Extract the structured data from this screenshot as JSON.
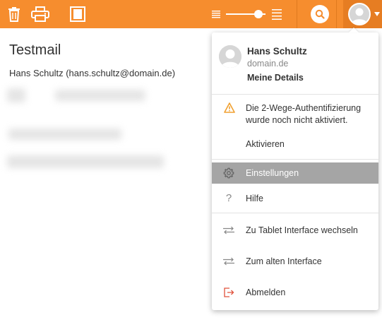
{
  "toolbar": {
    "icons": {
      "delete": "trash-icon",
      "print": "printer-icon",
      "view": "reading-pane-icon",
      "zoom_out": "text-size-small-icon",
      "zoom_in": "text-size-large-icon",
      "search": "search-icon",
      "account": "avatar-icon",
      "account_menu": "caret-down-icon"
    },
    "zoom_level": 0.82
  },
  "mail": {
    "subject": "Testmail",
    "from": "Hans Schultz (hans.schultz@domain.de)"
  },
  "account_menu": {
    "name": "Hans Schultz",
    "domain": "domain.de",
    "details_link": "Meine Details",
    "warning": {
      "icon": "warning-triangle-icon",
      "text": "Die 2-Wege-Authentifizierung wurde noch nicht aktiviert.",
      "action": "Aktivieren"
    },
    "items": [
      {
        "label": "Einstellungen",
        "icon": "gear-icon",
        "active": true
      },
      {
        "label": "Hilfe",
        "icon": "question-icon",
        "active": false
      },
      {
        "label": "Zu Tablet Interface wechseln",
        "icon": "switch-arrows-icon",
        "active": false
      },
      {
        "label": "Zum alten Interface",
        "icon": "switch-arrows-icon",
        "active": false
      },
      {
        "label": "Abmelden",
        "icon": "logout-icon",
        "active": false
      }
    ]
  },
  "colors": {
    "toolbar": "#f68d2e",
    "account_button": "#e67d22",
    "active_item": "#a5a5a5",
    "warning": "#f0a030",
    "logout": "#e0503a"
  }
}
